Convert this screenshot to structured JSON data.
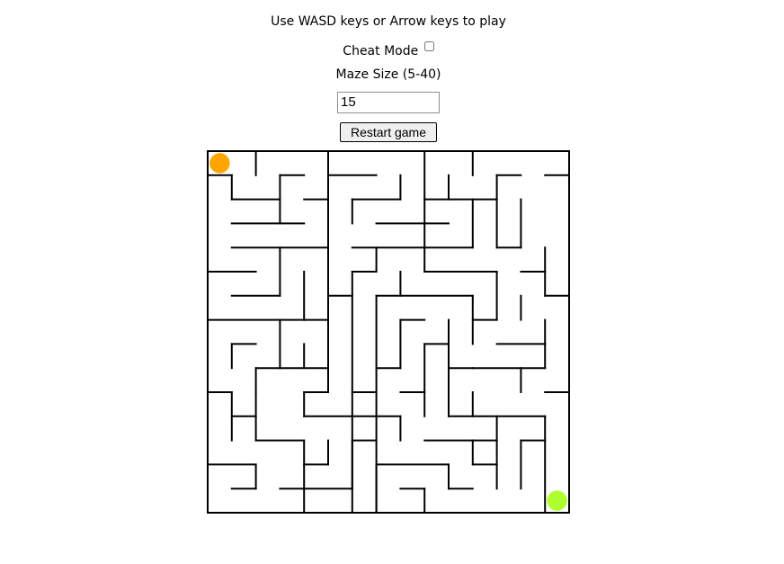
{
  "instructions": "Use WASD keys or Arrow keys to play",
  "cheat_mode": {
    "label": "Cheat Mode",
    "checked": false
  },
  "maze_size": {
    "label": "Maze Size (5-40)",
    "value": "15"
  },
  "restart_label": "Restart game",
  "game": {
    "grid_cells": 15,
    "player_cell": [
      0,
      0
    ],
    "goal_cell": [
      14,
      14
    ],
    "colors": {
      "wall": "#000000",
      "player": "#ffa500",
      "goal": "#adff2f",
      "background": "#ffffff"
    },
    "walls": [
      [
        0,
        0,
        15,
        0
      ],
      [
        0,
        0,
        0,
        15
      ],
      [
        15,
        0,
        15,
        15
      ],
      [
        0,
        15,
        15,
        15
      ],
      [
        2,
        0,
        2,
        1
      ],
      [
        5,
        0,
        5,
        2
      ],
      [
        9,
        0,
        9,
        2
      ],
      [
        11,
        0,
        11,
        1
      ],
      [
        0,
        1,
        1,
        1
      ],
      [
        1,
        1,
        1,
        2
      ],
      [
        3,
        1,
        4,
        1
      ],
      [
        5,
        1,
        7,
        1
      ],
      [
        8,
        1,
        8,
        2
      ],
      [
        10,
        1,
        10,
        2
      ],
      [
        12,
        1,
        13,
        1
      ],
      [
        12,
        1,
        12,
        4
      ],
      [
        14,
        1,
        15,
        1
      ],
      [
        1,
        2,
        3,
        2
      ],
      [
        3,
        1,
        3,
        3
      ],
      [
        4,
        2,
        5,
        2
      ],
      [
        6,
        2,
        8,
        2
      ],
      [
        6,
        2,
        6,
        3
      ],
      [
        9,
        2,
        12,
        2
      ],
      [
        13,
        2,
        13,
        4
      ],
      [
        1,
        3,
        4,
        3
      ],
      [
        7,
        3,
        10,
        3
      ],
      [
        9,
        2,
        9,
        4
      ],
      [
        11,
        2,
        11,
        4
      ],
      [
        1,
        4,
        5,
        4
      ],
      [
        6,
        4,
        11,
        4
      ],
      [
        12,
        4,
        13,
        4
      ],
      [
        3,
        4,
        3,
        6
      ],
      [
        5,
        2,
        5,
        6
      ],
      [
        6,
        5,
        7,
        5
      ],
      [
        7,
        4,
        7,
        5
      ],
      [
        9,
        4,
        9,
        5
      ],
      [
        9,
        5,
        12,
        5
      ],
      [
        12,
        5,
        12,
        7
      ],
      [
        14,
        4,
        14,
        6
      ],
      [
        0,
        5,
        2,
        5
      ],
      [
        13,
        5,
        14,
        5
      ],
      [
        5,
        6,
        6,
        6
      ],
      [
        6,
        5,
        6,
        15
      ],
      [
        8,
        5,
        8,
        6
      ],
      [
        1,
        6,
        3,
        6
      ],
      [
        4,
        5,
        4,
        7
      ],
      [
        7,
        6,
        11,
        6
      ],
      [
        7,
        6,
        7,
        15
      ],
      [
        11,
        6,
        11,
        8
      ],
      [
        13,
        6,
        13,
        7
      ],
      [
        14,
        6,
        15,
        6
      ],
      [
        0,
        7,
        4,
        7
      ],
      [
        4,
        7,
        5,
        7
      ],
      [
        5,
        6,
        5,
        10
      ],
      [
        8,
        7,
        9,
        7
      ],
      [
        8,
        7,
        8,
        9
      ],
      [
        11,
        7,
        12,
        7
      ],
      [
        12,
        8,
        14,
        8
      ],
      [
        14,
        8,
        14,
        9
      ],
      [
        1,
        8,
        2,
        8
      ],
      [
        1,
        8,
        1,
        9
      ],
      [
        3,
        7,
        3,
        9
      ],
      [
        4,
        8,
        4,
        9
      ],
      [
        9,
        8,
        10,
        8
      ],
      [
        9,
        8,
        9,
        11
      ],
      [
        10,
        7,
        10,
        9
      ],
      [
        14,
        7,
        14,
        8
      ],
      [
        2,
        9,
        3,
        9
      ],
      [
        2,
        9,
        2,
        10
      ],
      [
        3,
        9,
        5,
        9
      ],
      [
        7,
        9,
        8,
        9
      ],
      [
        11,
        9,
        14,
        9
      ],
      [
        10,
        9,
        11,
        9
      ],
      [
        10,
        9,
        10,
        11
      ],
      [
        13,
        9,
        13,
        10
      ],
      [
        0,
        10,
        1,
        10
      ],
      [
        1,
        10,
        1,
        12
      ],
      [
        2,
        10,
        2,
        11
      ],
      [
        4,
        10,
        5,
        10
      ],
      [
        4,
        10,
        4,
        11
      ],
      [
        6,
        10,
        7,
        10
      ],
      [
        8,
        10,
        9,
        10
      ],
      [
        11,
        10,
        11,
        11
      ],
      [
        10,
        11,
        14,
        11
      ],
      [
        14,
        10,
        15,
        10
      ],
      [
        1,
        11,
        2,
        11
      ],
      [
        4,
        11,
        6,
        11
      ],
      [
        6,
        11,
        8,
        11
      ],
      [
        8,
        11,
        8,
        12
      ],
      [
        12,
        11,
        12,
        14
      ],
      [
        14,
        11,
        14,
        15
      ],
      [
        2,
        12,
        4,
        12
      ],
      [
        2,
        11,
        2,
        12
      ],
      [
        4,
        12,
        4,
        15
      ],
      [
        6,
        12,
        7,
        12
      ],
      [
        9,
        12,
        11,
        12
      ],
      [
        11,
        12,
        11,
        13
      ],
      [
        11,
        12,
        12,
        12
      ],
      [
        13,
        12,
        14,
        12
      ],
      [
        4,
        13,
        5,
        13
      ],
      [
        5,
        12,
        5,
        13
      ],
      [
        7,
        13,
        10,
        13
      ],
      [
        7,
        13,
        7,
        15
      ],
      [
        10,
        13,
        10,
        14
      ],
      [
        10,
        14,
        11,
        14
      ],
      [
        11,
        13,
        12,
        13
      ],
      [
        13,
        12,
        13,
        14
      ],
      [
        0,
        13,
        2,
        13
      ],
      [
        2,
        13,
        2,
        14
      ],
      [
        1,
        14,
        2,
        14
      ],
      [
        3,
        14,
        6,
        14
      ],
      [
        6,
        12,
        6,
        14
      ],
      [
        8,
        14,
        9,
        14
      ],
      [
        9,
        14,
        9,
        15
      ]
    ]
  }
}
